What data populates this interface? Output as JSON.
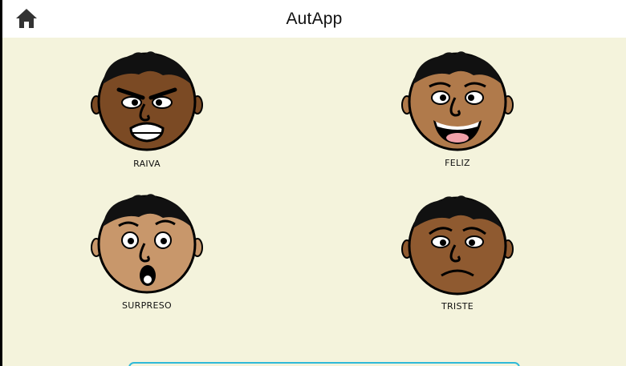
{
  "app": {
    "title": "AutApp"
  },
  "icons": {
    "home": "home-icon"
  },
  "colors": {
    "background": "#f4f3dc",
    "topbar": "#ffffff",
    "accent": "#2fb9d8"
  },
  "emotions": [
    {
      "label": "RAIVA"
    },
    {
      "label": "FELIZ"
    },
    {
      "label": "SURPRESO"
    },
    {
      "label": "TRISTE"
    }
  ]
}
